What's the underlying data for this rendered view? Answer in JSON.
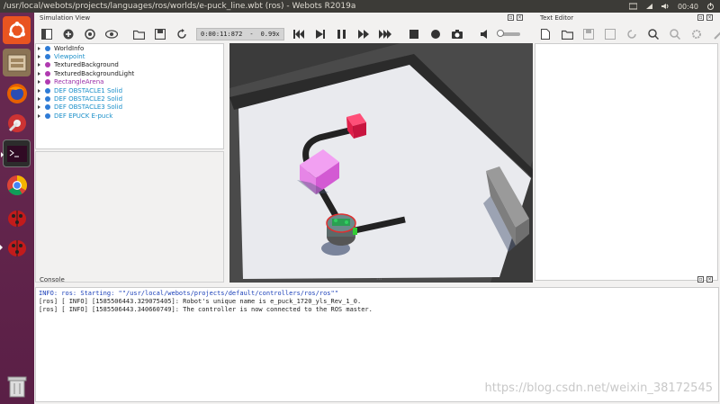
{
  "window": {
    "title": "/usr/local/webots/projects/languages/ros/worlds/e-puck_line.wbt (ros) - Webots R2019a",
    "time": "00:40"
  },
  "panels": {
    "simulation_view": "Simulation View",
    "text_editor": "Text Editor",
    "console": "Console"
  },
  "toolbar": {
    "sim_time": "0:00:11:872",
    "separator": "-",
    "speed": "0.99x"
  },
  "scene_tree": [
    {
      "label": "WorldInfo",
      "dot": "#2e7bd6",
      "color": "#222222"
    },
    {
      "label": "Viewpoint",
      "dot": "#2e7bd6",
      "color": "#1a8fc9"
    },
    {
      "label": "TexturedBackground",
      "dot": "#b03ab0",
      "color": "#222222"
    },
    {
      "label": "TexturedBackgroundLight",
      "dot": "#b03ab0",
      "color": "#222222"
    },
    {
      "label": "RectangleArena",
      "dot": "#b03ab0",
      "color": "#9b2fa8"
    },
    {
      "label": "DEF OBSTACLE1 Solid",
      "dot": "#2e7bd6",
      "color": "#1a8fc9"
    },
    {
      "label": "DEF OBSTACLE2 Solid",
      "dot": "#2e7bd6",
      "color": "#1a8fc9"
    },
    {
      "label": "DEF OBSTACLE3 Solid",
      "dot": "#2e7bd6",
      "color": "#1a8fc9"
    },
    {
      "label": "DEF EPUCK E-puck",
      "dot": "#2e7bd6",
      "color": "#1a8fc9"
    }
  ],
  "console": {
    "lines": [
      {
        "text": "INFO: ros: Starting: \"\"/usr/local/webots/projects/default/controllers/ros/ros\"\"",
        "color": "#1a3fb8"
      },
      {
        "text": "[ros] [ INFO] [1585506443.329075405]: Robot's unique name is e_puck_1720_yls_Rev_1_0.",
        "color": "#222222"
      },
      {
        "text": "[ros] [ INFO] [1585506443.340660749]: The controller is now connected to the ROS master.",
        "color": "#222222"
      }
    ]
  },
  "watermark": "https://blog.csdn.net/weixin_38172545",
  "colors": {
    "launcher": "#5e2750",
    "topbar": "#3c3b37",
    "arena_floor": "#e9eaee",
    "obstacle_pink": "#e070e0",
    "obstacle_red": "#d8284a"
  }
}
